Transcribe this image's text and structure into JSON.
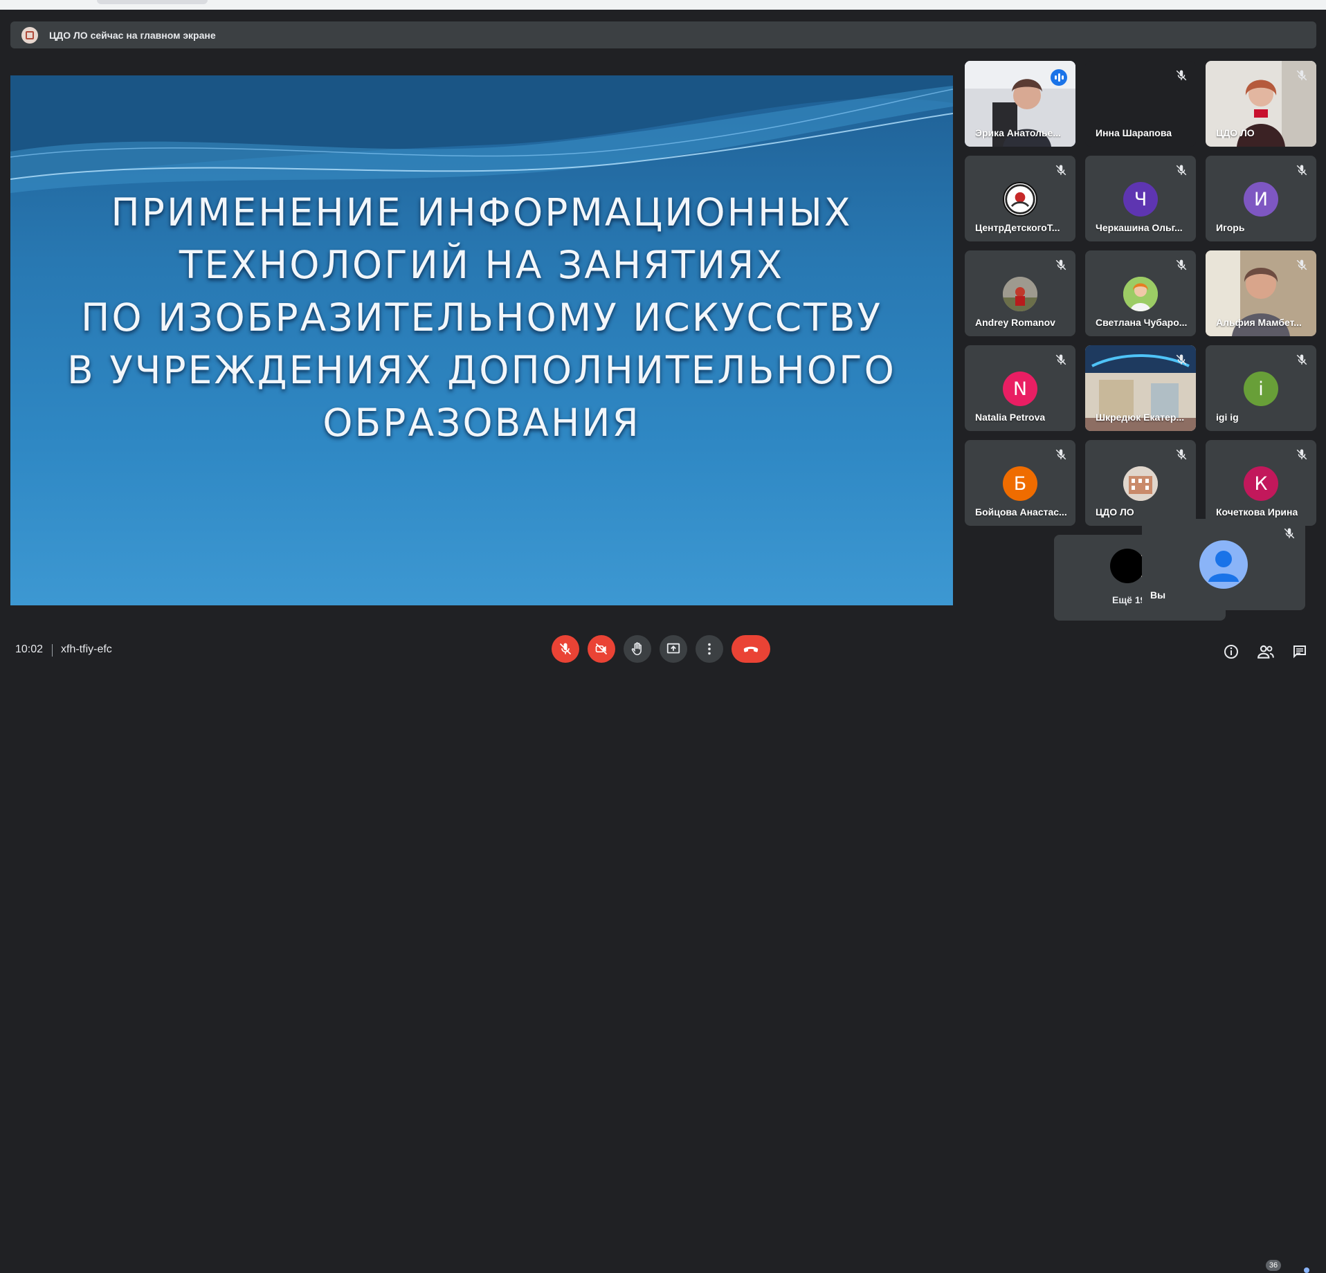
{
  "banner": {
    "text": "ЦДО ЛО сейчас на главном экране"
  },
  "slide": {
    "lines": [
      "ПРИМЕНЕНИЕ ИНФОРМАЦИОННЫХ",
      "ТЕХНОЛОГИЙ НА ЗАНЯТИЯХ",
      "ПО ИЗОБРАЗИТЕЛЬНОМУ ИСКУССТВУ",
      "В УЧРЕЖДЕНИЯХ ДОПОЛНИТЕЛЬНОГО",
      "ОБРАЗОВАНИЯ"
    ]
  },
  "participants": [
    {
      "name": "Эрика Анатолье...",
      "type": "video-speaking"
    },
    {
      "name": "Инна Шарапова",
      "type": "dark"
    },
    {
      "name": "ЦДО ЛО",
      "type": "video"
    },
    {
      "name": "ЦентрДетскогоТ...",
      "type": "image-avatar"
    },
    {
      "name": "Черкашина Ольг...",
      "type": "letter",
      "letter": "Ч",
      "color": "#5e35b1"
    },
    {
      "name": "Игорь",
      "type": "letter",
      "letter": "И",
      "color": "#7e57c2"
    },
    {
      "name": "Andrey Romanov",
      "type": "image-avatar"
    },
    {
      "name": "Светлана Чубаро...",
      "type": "image-avatar"
    },
    {
      "name": "Альфия Мамбет...",
      "type": "video"
    },
    {
      "name": "Natalia Petrova",
      "type": "letter",
      "letter": "N",
      "color": "#e91e63"
    },
    {
      "name": "Шкредюк Екатер...",
      "type": "video"
    },
    {
      "name": "igi ig",
      "type": "letter",
      "letter": "i",
      "color": "#689f38"
    },
    {
      "name": "Бойцова Анастас...",
      "type": "letter",
      "letter": "Б",
      "color": "#ef6c00"
    },
    {
      "name": "ЦДО ЛО",
      "type": "image-avatar"
    },
    {
      "name": "Кочеткова Ирина",
      "type": "letter",
      "letter": "К",
      "color": "#c2185b"
    }
  ],
  "more": {
    "label": "Ещё 19"
  },
  "self": {
    "name": "Вы"
  },
  "bottom": {
    "time": "10:02",
    "meeting_code": "xfh-tfiy-efc",
    "participants_count": "36"
  },
  "icons": {
    "mic": "mic-off-icon",
    "camera": "camera-off-icon",
    "hand": "raise-hand-icon",
    "present": "present-icon",
    "more": "more-options-icon",
    "hangup": "hang-up-icon",
    "info": "info-icon",
    "people": "people-icon",
    "chat": "chat-icon"
  },
  "colors": {
    "hangup": "#ea4335",
    "active_outline": "#8ab4f8",
    "tile_bg": "#3c4043",
    "page_bg": "#202124"
  }
}
